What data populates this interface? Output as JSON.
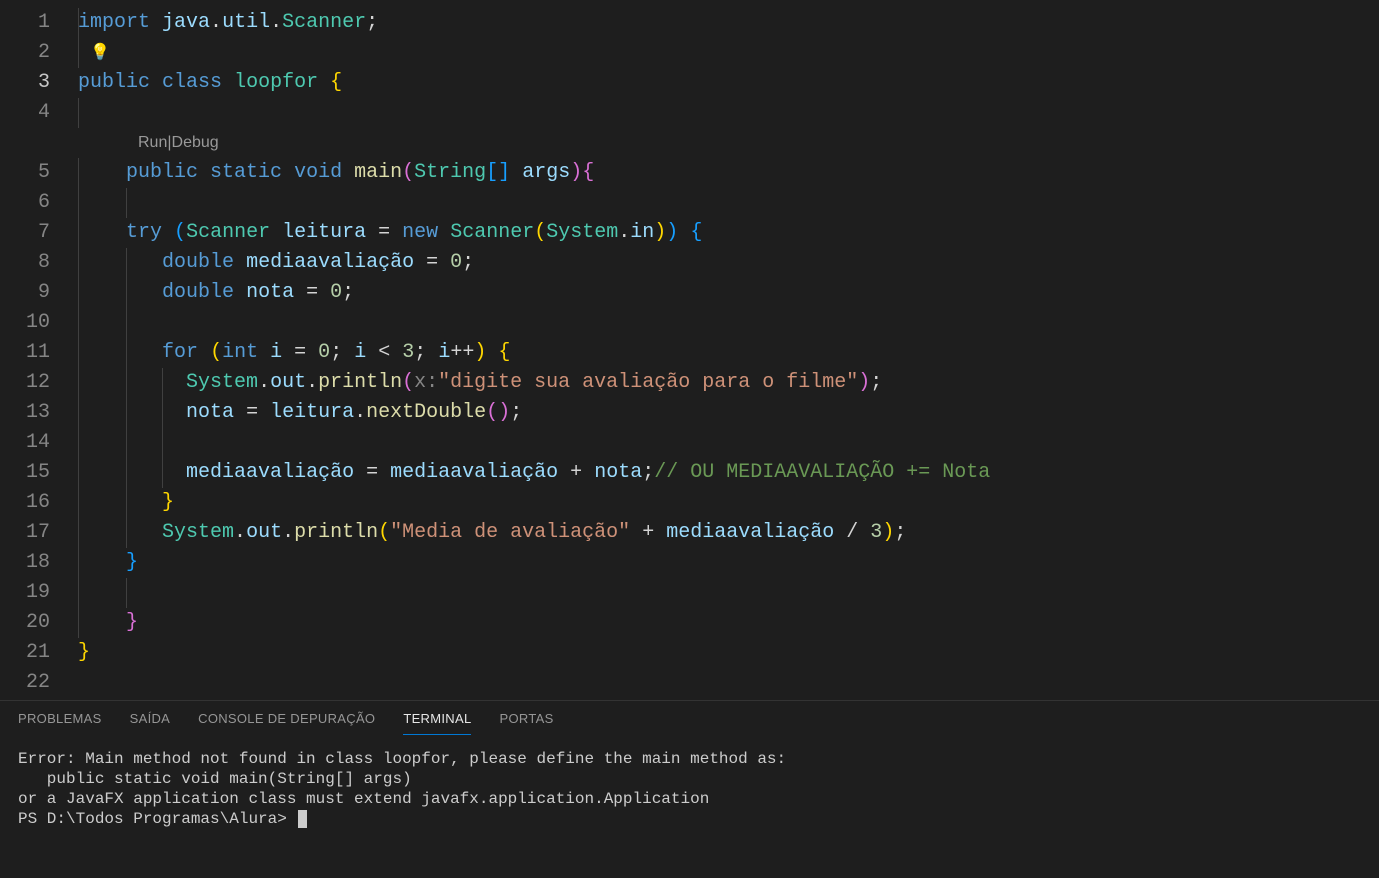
{
  "gutter": {
    "lines": [
      "1",
      "2",
      "3",
      "4",
      "5",
      "6",
      "7",
      "8",
      "9",
      "10",
      "11",
      "12",
      "13",
      "14",
      "15",
      "16",
      "17",
      "18",
      "19",
      "20",
      "21",
      "22"
    ],
    "active": 3
  },
  "codelens": {
    "run": "Run",
    "sep": " | ",
    "debug": "Debug"
  },
  "code": {
    "l1_import": "import",
    "l1_pkg": "java",
    "l1_util": "util",
    "l1_scanner": "Scanner",
    "l3_public": "public",
    "l3_class": "class",
    "l3_name": "loopfor",
    "l3_brace": "{",
    "l5_public": "public",
    "l5_static": "static",
    "l5_void": "void",
    "l5_main": "main",
    "l5_string": "String",
    "l5_args": "args",
    "l7_try": "try",
    "l7_scannerT": "Scanner",
    "l7_leitura": "leitura",
    "l7_new": "new",
    "l7_scannerC": "Scanner",
    "l7_system": "System",
    "l7_in": "in",
    "l8_double": "double",
    "l8_media": "mediaavaliação",
    "l8_zero": "0",
    "l9_double": "double",
    "l9_nota": "nota",
    "l9_zero": "0",
    "l11_for": "for",
    "l11_int": "int",
    "l11_i1": "i",
    "l11_zero": "0",
    "l11_i2": "i",
    "l11_three": "3",
    "l11_i3": "i",
    "l12_system": "System",
    "l12_out": "out",
    "l12_println": "println",
    "l12_hint": "x:",
    "l12_str": "\"digite sua avaliação para o filme\"",
    "l13_nota": "nota",
    "l13_leitura": "leitura",
    "l13_nextDouble": "nextDouble",
    "l15_media1": "mediaavaliação",
    "l15_media2": "mediaavaliação",
    "l15_nota": "nota",
    "l15_cmt": "// OU MEDIAAVALIAÇÃO += Nota",
    "l17_system": "System",
    "l17_out": "out",
    "l17_println": "println",
    "l17_str": "\"Media de avaliação\"",
    "l17_media": "mediaavaliação",
    "l17_three": "3"
  },
  "panel": {
    "tabs": {
      "problems": "PROBLEMAS",
      "output": "SAÍDA",
      "debug": "CONSOLE DE DEPURAÇÃO",
      "terminal": "TERMINAL",
      "ports": "PORTAS"
    },
    "terminal": {
      "l1": "Error: Main method not found in class loopfor, please define the main method as:",
      "l2": "   public static void main(String[] args)",
      "l3": "or a JavaFX application class must extend javafx.application.Application",
      "l4": "PS D:\\Todos Programas\\Alura> "
    }
  }
}
